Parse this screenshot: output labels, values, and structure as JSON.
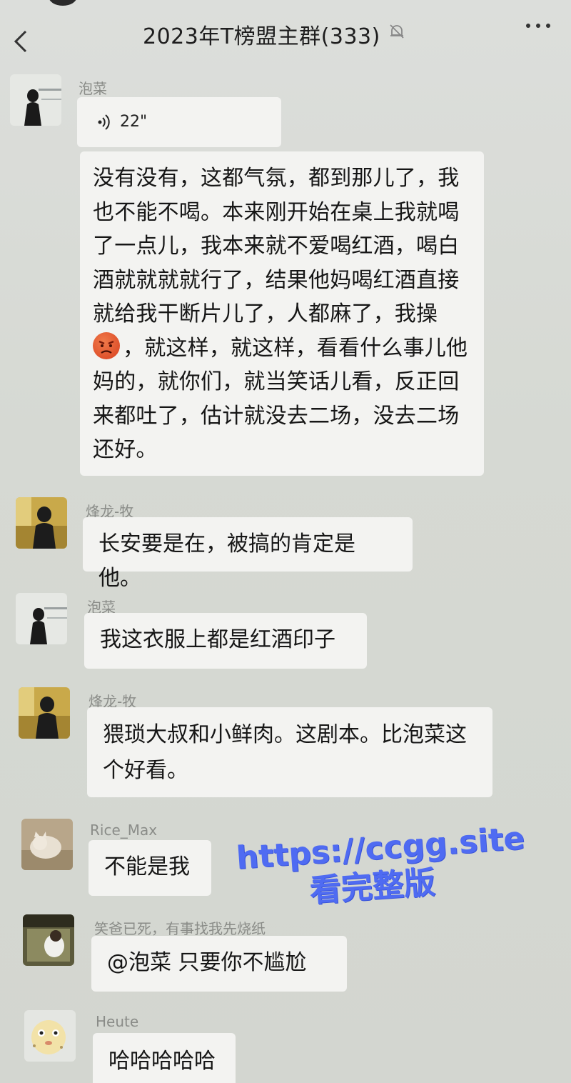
{
  "header": {
    "title": "2023年T榜盟主群(333)",
    "mute_icon": "bell-slash-icon",
    "back_icon": "chevron-left-icon",
    "more_icon": "more-dots-icon"
  },
  "messages": [
    {
      "sender": "泡菜",
      "voice_duration": "22\""
    },
    {
      "sender": "泡菜",
      "lines": [
        "没有没有，这都气氛，都到那儿了，我",
        "也不能不喝。本来刚开始在桌上我就喝",
        "了一点儿，我本来就不爱喝红酒，喝白",
        "酒就就就就行了，结果他妈喝红酒直接",
        "就给我干断片儿了，人都麻了，我操",
        "，就这样，就这样，看看什么事儿他",
        "妈的，就你们，就当笑话儿看，反正回",
        "来都吐了，估计就没去二场，没去二场",
        "还好。"
      ],
      "emoji": "angry-face-icon"
    },
    {
      "sender": "烽龙-牧",
      "text": "长安要是在，被搞的肯定是他。"
    },
    {
      "sender": "泡菜",
      "text": "我这衣服上都是红酒印子"
    },
    {
      "sender": "烽龙-牧",
      "lines": [
        "猥琐大叔和小鲜肉。这剧本。比泡菜这",
        "个好看。"
      ]
    },
    {
      "sender": "Rice_Max",
      "text": "不能是我"
    },
    {
      "sender": "笑爸已死，有事找我先烧纸",
      "text": "@泡菜   只要你不尴尬"
    },
    {
      "sender": "Heute",
      "text": "哈哈哈哈哈"
    }
  ],
  "watermark": {
    "line1": "https://ccgg.site",
    "line2": "看完整版"
  },
  "colors": {
    "bubble": "#f3f3f1",
    "background": "#d9dbd6",
    "watermark": "#4f6bf2"
  }
}
